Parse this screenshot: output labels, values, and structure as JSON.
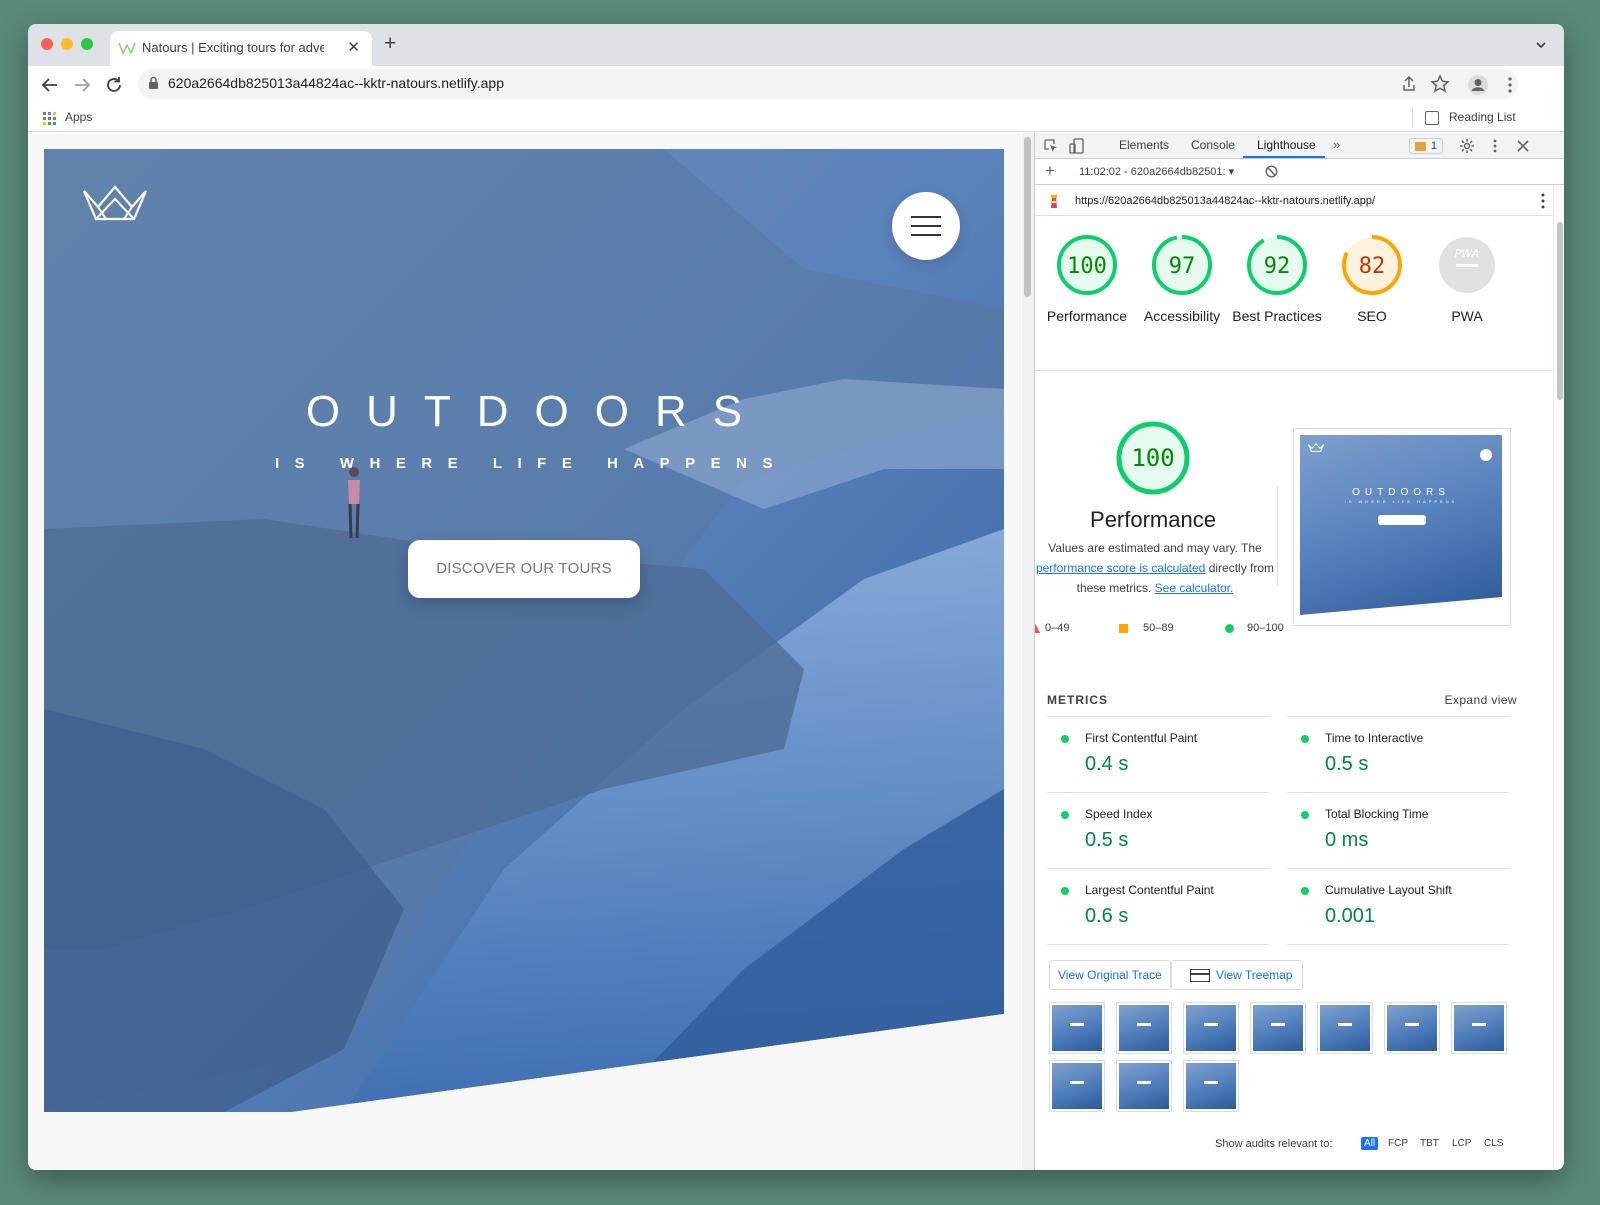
{
  "browser": {
    "tab_title": "Natours | Exciting tours for adventurous people",
    "url": "620a2664db825013a44824ac--kktr-natours.netlify.app",
    "bookmarks_apps": "Apps",
    "reading_list": "Reading List",
    "new_tab_icon": "plus-icon",
    "close_tab_icon": "x-icon"
  },
  "hero": {
    "title": "OUTDOORS",
    "subtitle": "IS WHERE LIFE HAPPENS",
    "cta": "DISCOVER OUR TOURS"
  },
  "devtools": {
    "tabs": [
      "Elements",
      "Console",
      "Lighthouse"
    ],
    "active_tab": "Lighthouse",
    "issues_count": "1",
    "report_label": "11:02:02 - 620a2664db82501:",
    "report_url": "https://620a2664db825013a44824ac--kktr-natours.netlify.app/"
  },
  "lighthouse": {
    "scores": [
      {
        "value": "100",
        "label": "Performance",
        "color": "#0cce6b",
        "text": "#008800",
        "fill": "#e6faef",
        "pct": 100
      },
      {
        "value": "97",
        "label": "Accessibility",
        "color": "#0cce6b",
        "text": "#008800",
        "fill": "#e6faef",
        "pct": 97
      },
      {
        "value": "92",
        "label": "Best Practices",
        "color": "#0cce6b",
        "text": "#008800",
        "fill": "#e6faef",
        "pct": 92
      },
      {
        "value": "82",
        "label": "SEO",
        "color": "#ffa400",
        "text": "#c33300",
        "fill": "#fff3e0",
        "pct": 82
      },
      {
        "value": "PWA",
        "label": "PWA",
        "color": "#cccccc",
        "text": "#ffffff",
        "fill": "#e0e0e0",
        "pct": 0
      }
    ],
    "perf": {
      "score": "100",
      "title": "Performance",
      "desc_1": "Values are estimated and may vary. The",
      "desc_link": "performance score is calculated",
      "desc_2": "directly from",
      "desc_3": "these metrics.",
      "desc_link2": "See calculator."
    },
    "legend": [
      {
        "label": "0–49",
        "color": "#ff4e42"
      },
      {
        "label": "50–89",
        "color": "#ffa400"
      },
      {
        "label": "90–100",
        "color": "#0cce6b"
      }
    ],
    "screenshot": {
      "title": "OUTDOORS",
      "subtitle": "IS WHERE LIFE HAPPENS"
    },
    "metrics_heading": "METRICS",
    "expand_view": "Expand view",
    "metrics": [
      {
        "name": "First Contentful Paint",
        "value": "0.4 s"
      },
      {
        "name": "Time to Interactive",
        "value": "0.5 s"
      },
      {
        "name": "Speed Index",
        "value": "0.5 s"
      },
      {
        "name": "Total Blocking Time",
        "value": "0 ms"
      },
      {
        "name": "Largest Contentful Paint",
        "value": "0.6 s"
      },
      {
        "name": "Cumulative Layout Shift",
        "value": "0.001"
      }
    ],
    "view_trace": "View Original Trace",
    "view_treemap": "View Treemap",
    "filmstrip_count": 10,
    "audits_label": "Show audits relevant to:",
    "audit_filters": [
      "All",
      "FCP",
      "TBT",
      "LCP",
      "CLS"
    ]
  }
}
